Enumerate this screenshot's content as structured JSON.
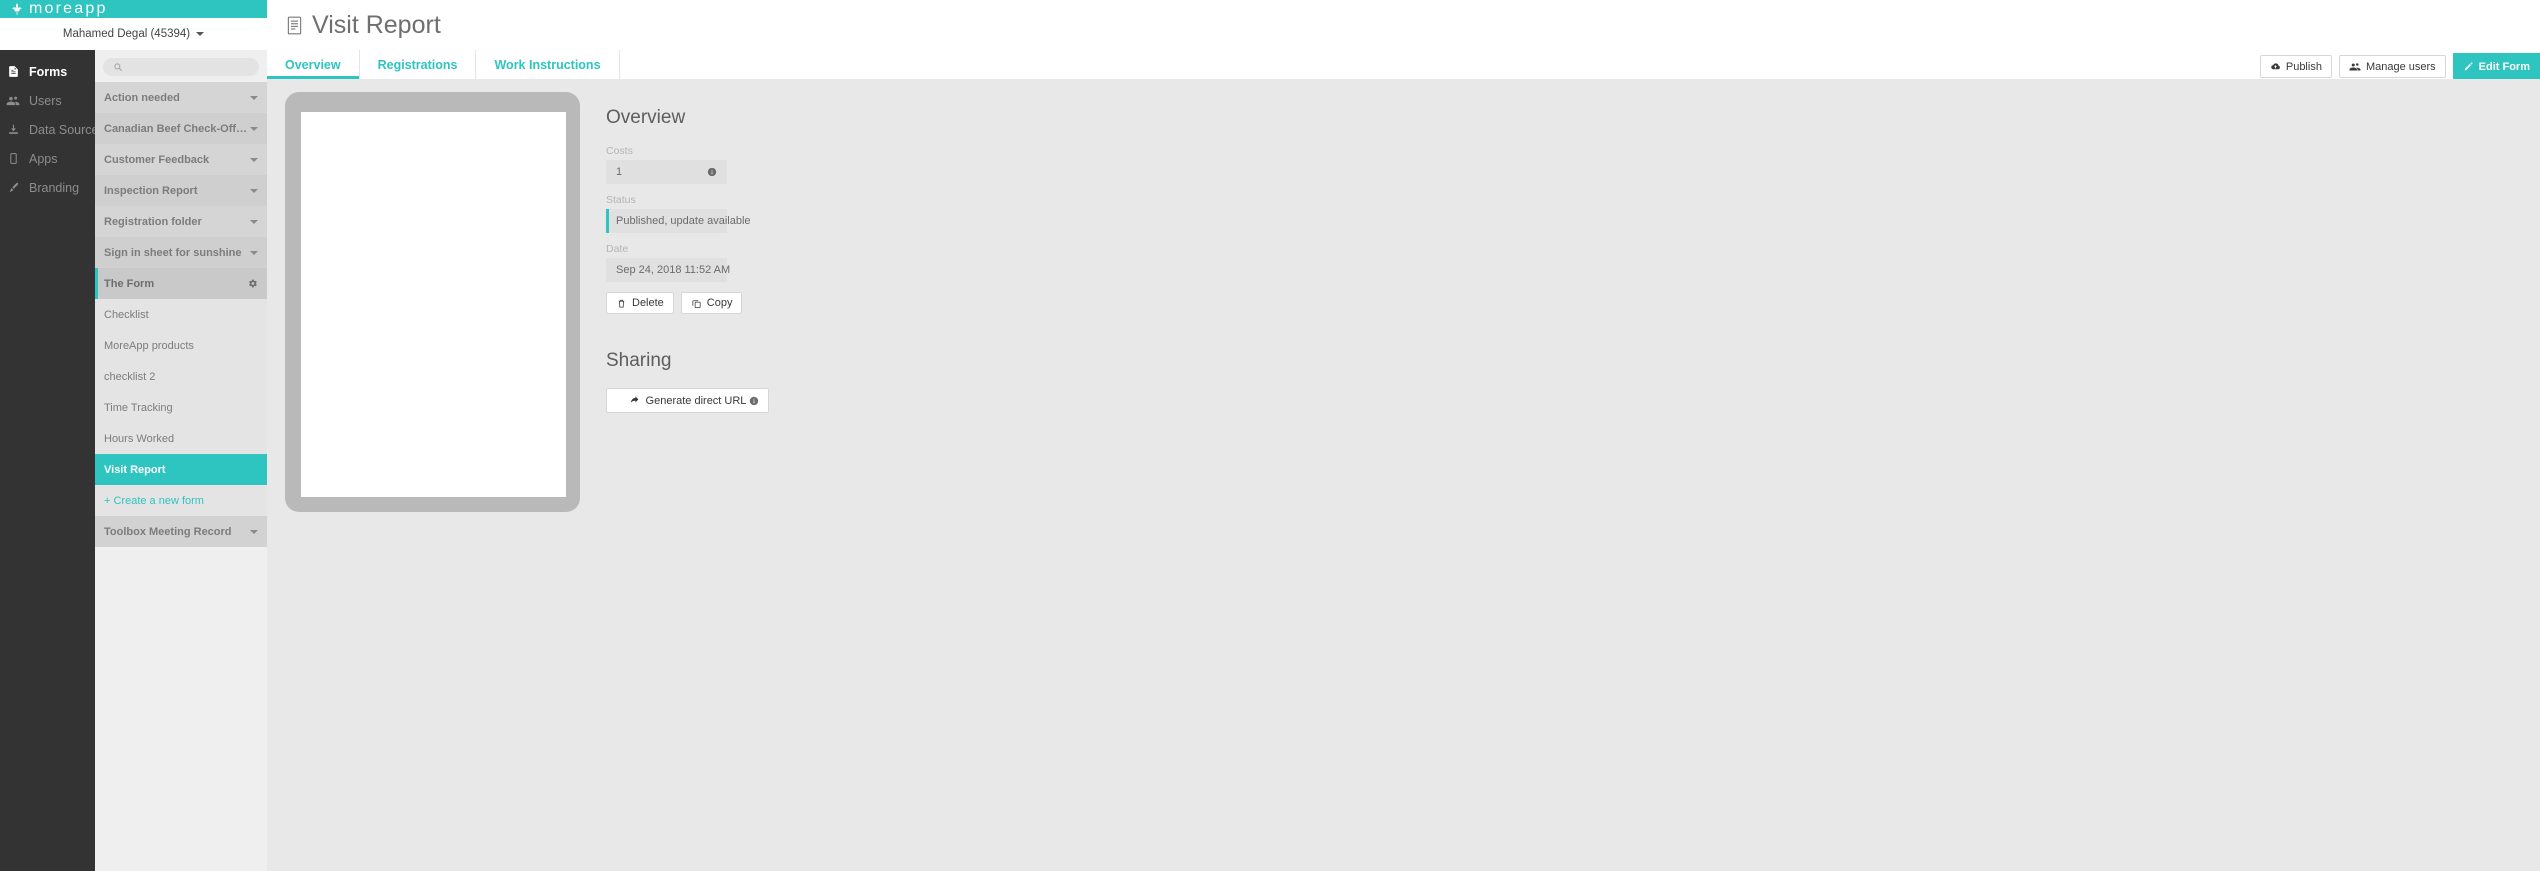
{
  "brand": {
    "wordmark": "moreapp",
    "logo_icon": "moreapp-leaf-icon",
    "bar_color": "#2ec4c0"
  },
  "account": {
    "name": "Mahamed Degal (45394)",
    "caret_icon": "caret-down-icon"
  },
  "nav": {
    "items": [
      {
        "label": "Forms",
        "icon": "document-icon",
        "active": true
      },
      {
        "label": "Users",
        "icon": "users-icon",
        "active": false
      },
      {
        "label": "Data Sources",
        "icon": "download-icon",
        "active": false
      },
      {
        "label": "Apps",
        "icon": "tablet-icon",
        "active": false
      },
      {
        "label": "Branding",
        "icon": "paintbrush-icon",
        "active": false
      }
    ]
  },
  "forms_panel": {
    "search": {
      "value": "",
      "placeholder": "",
      "icon": "search-icon"
    },
    "folders": [
      {
        "label": "Action needed",
        "caret_icon": "caret-down-icon",
        "open": false
      },
      {
        "label": "Canadian Beef Check-Off Inspec...",
        "caret_icon": "caret-down-icon",
        "open": false
      },
      {
        "label": "Customer Feedback",
        "caret_icon": "caret-down-icon",
        "open": false
      },
      {
        "label": "Inspection Report",
        "caret_icon": "caret-down-icon",
        "open": false
      },
      {
        "label": "Registration folder",
        "caret_icon": "caret-down-icon",
        "open": false
      },
      {
        "label": "Sign in sheet for sunshine",
        "caret_icon": "caret-down-icon",
        "open": false
      }
    ],
    "open_folder": {
      "label": "The Form",
      "gear_icon": "gear-icon"
    },
    "forms": [
      {
        "label": "Checklist",
        "selected": false
      },
      {
        "label": "MoreApp products",
        "selected": false
      },
      {
        "label": "checklist 2",
        "selected": false
      },
      {
        "label": "Time Tracking",
        "selected": false
      },
      {
        "label": "Hours Worked",
        "selected": false
      },
      {
        "label": "Visit Report",
        "selected": true
      }
    ],
    "create_new": "+ Create a new form",
    "folders_after": [
      {
        "label": "Toolbox Meeting Record",
        "caret_icon": "caret-down-icon",
        "open": false
      }
    ]
  },
  "page": {
    "title": "Visit Report",
    "title_icon": "form-document-icon"
  },
  "tabs": [
    {
      "label": "Overview",
      "active": true
    },
    {
      "label": "Registrations",
      "active": false
    },
    {
      "label": "Work Instructions",
      "active": false
    }
  ],
  "header_actions": {
    "publish": {
      "label": "Publish",
      "icon": "cloud-upload-icon"
    },
    "manage_users": {
      "label": "Manage users",
      "icon": "users-icon"
    },
    "edit_form": {
      "label": "Edit Form",
      "icon": "pencil-icon"
    }
  },
  "overview": {
    "heading": "Overview",
    "costs": {
      "label": "Costs",
      "value": "1",
      "info_icon": "info-icon"
    },
    "status": {
      "label": "Status",
      "value": "Published, update available",
      "accent": "#2ec4c0"
    },
    "date": {
      "label": "Date",
      "value": "Sep 24, 2018 11:52 AM"
    },
    "delete": {
      "label": "Delete",
      "icon": "trash-icon"
    },
    "copy": {
      "label": "Copy",
      "icon": "copy-icon"
    }
  },
  "sharing": {
    "heading": "Sharing",
    "generate_url": {
      "label": "Generate direct URL",
      "icon": "share-external-icon",
      "info_icon": "info-icon"
    }
  },
  "colors": {
    "accent": "#2ec4c0",
    "sidebar_dark": "#333333",
    "content_bg": "#e8e8e8",
    "panel_bg": "#efefef"
  }
}
